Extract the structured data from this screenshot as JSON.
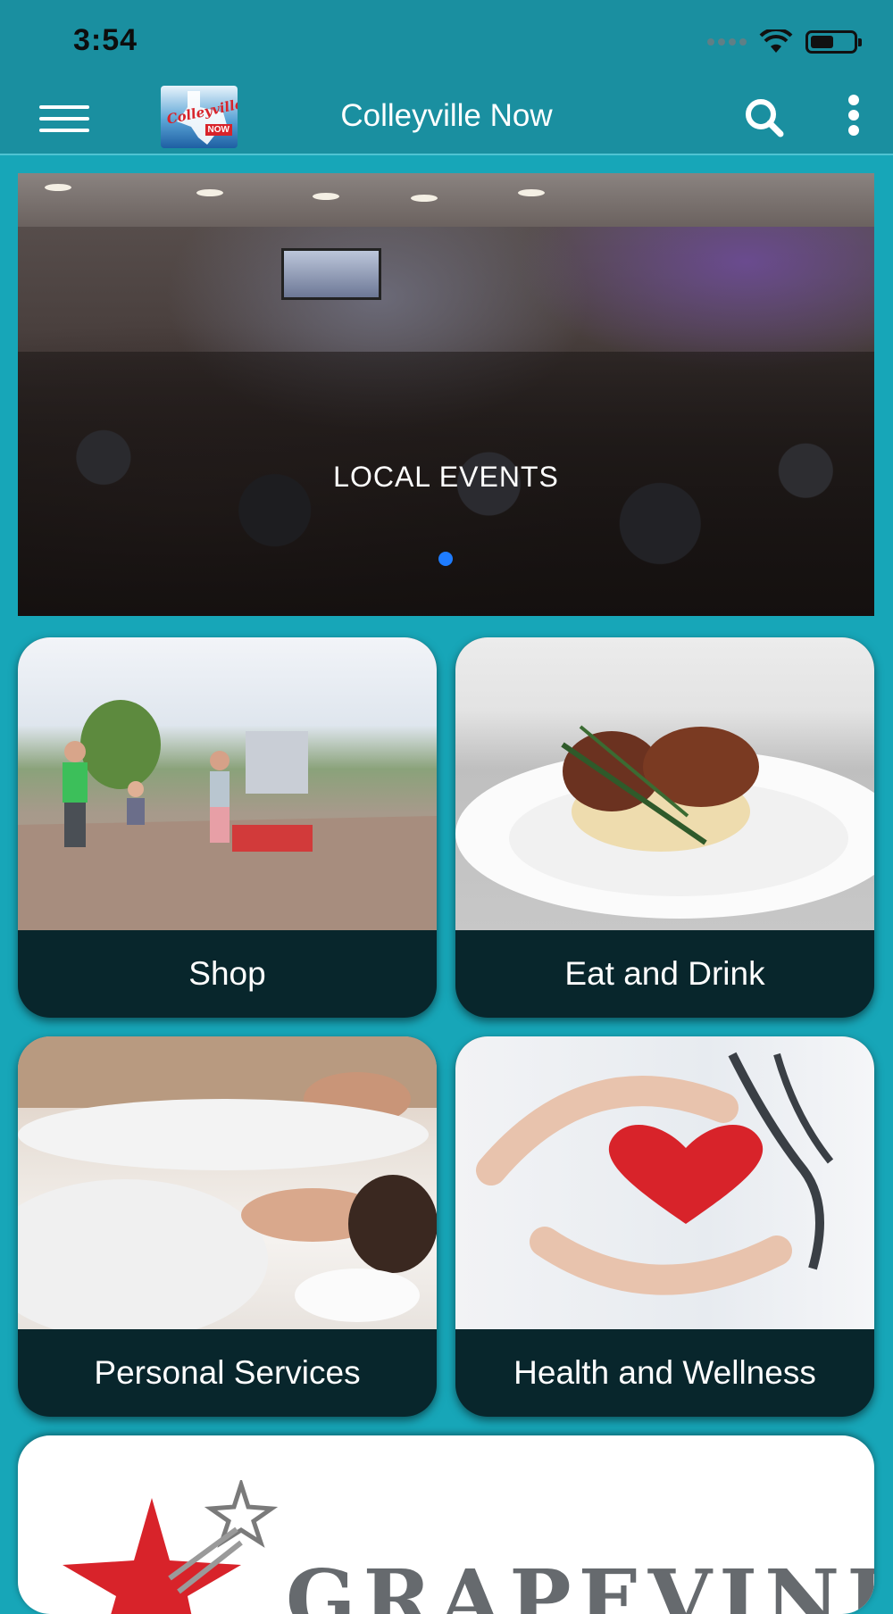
{
  "status": {
    "time": "3:54",
    "battery_level": 0.55
  },
  "appbar": {
    "title": "Colleyville Now",
    "logo_text": "Colleyville",
    "logo_sub": "NOW",
    "menu_icon": "hamburger-menu-icon",
    "search_icon": "search-icon",
    "more_icon": "more-vertical-icon"
  },
  "hero": {
    "caption": "LOCAL EVENTS",
    "page_indicator": {
      "current": 1,
      "total": 1
    }
  },
  "tiles": [
    {
      "label": "Shop"
    },
    {
      "label": "Eat and Drink"
    },
    {
      "label": "Personal Services"
    },
    {
      "label": "Health and Wellness"
    }
  ],
  "banner": {
    "text": "GRAPEVINE"
  },
  "colors": {
    "appbar": "#1a8fa0",
    "background": "#17a6b8",
    "tile_label_bg": "#08262c",
    "indicator": "#1e7cff"
  }
}
